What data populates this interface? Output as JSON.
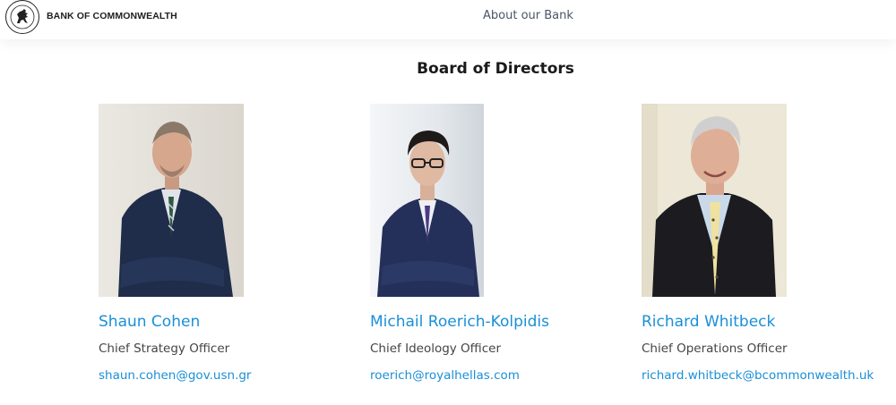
{
  "header": {
    "brand": "BANK OF COMMONWEALTH",
    "logo_icon": "lion-rampant-icon",
    "nav_link": "About our Bank"
  },
  "section": {
    "title": "Board of Directors"
  },
  "directors": [
    {
      "name": "Shaun Cohen",
      "role": "Chief Strategy Officer",
      "email": "shaun.cohen@gov.usn.gr",
      "photo_icon": "portrait-photo"
    },
    {
      "name": "Michail Roerich-Kolpidis",
      "role": "Chief Ideology Officer",
      "email": "roerich@royalhellas.com",
      "photo_icon": "portrait-photo"
    },
    {
      "name": "Richard Whitbeck",
      "role": "Chief Operations Officer",
      "email": "richard.whitbeck@bcommonwealth.uk",
      "photo_icon": "portrait-photo"
    }
  ],
  "colors": {
    "accent": "#1a8fd6",
    "title": "#1a1a1a",
    "nav": "#4a5568",
    "body_text": "#444444"
  }
}
